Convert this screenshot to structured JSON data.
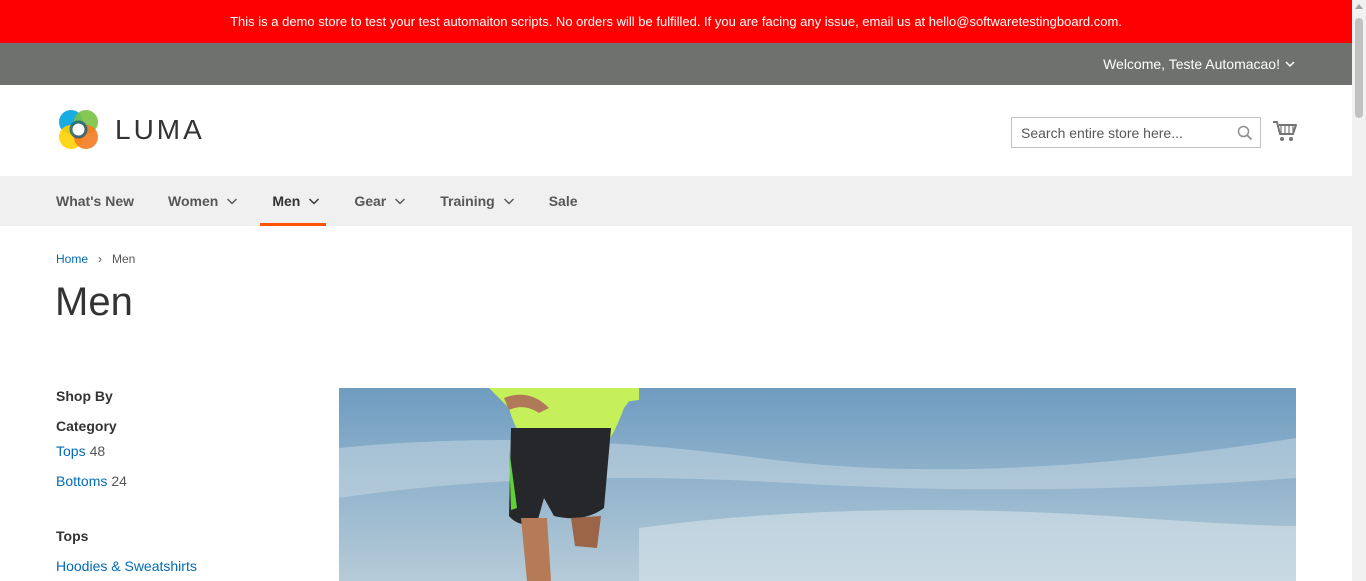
{
  "banner": {
    "text": "This is a demo store to test your test automaiton scripts. No orders will be fulfilled. If you are facing any issue, email us at hello@softwaretestingboard.com."
  },
  "header": {
    "welcome": "Welcome, Teste Automacao!",
    "logo_text": "LUMA",
    "search_placeholder": "Search entire store here...",
    "search_icon": "search-icon",
    "cart_icon": "cart-icon"
  },
  "nav": {
    "items": [
      {
        "label": "What's New",
        "has_dropdown": false
      },
      {
        "label": "Women",
        "has_dropdown": true
      },
      {
        "label": "Men",
        "has_dropdown": true,
        "active": true
      },
      {
        "label": "Gear",
        "has_dropdown": true
      },
      {
        "label": "Training",
        "has_dropdown": true
      },
      {
        "label": "Sale",
        "has_dropdown": false
      }
    ]
  },
  "breadcrumbs": {
    "home": "Home",
    "separator": "›",
    "current": "Men"
  },
  "page": {
    "title": "Men"
  },
  "sidebar": {
    "shop_by": "Shop By",
    "category_title": "Category",
    "categories": [
      {
        "label": "Tops",
        "count": "48"
      },
      {
        "label": "Bottoms",
        "count": "24"
      }
    ],
    "tops_title": "Tops",
    "tops_links": [
      "Hoodies & Sweatshirts"
    ]
  },
  "colors": {
    "banner": "#ff0000",
    "panel": "#6e716e",
    "nav_bg": "#f0f0f0",
    "accent": "#ff5501",
    "link": "#006bb4"
  }
}
